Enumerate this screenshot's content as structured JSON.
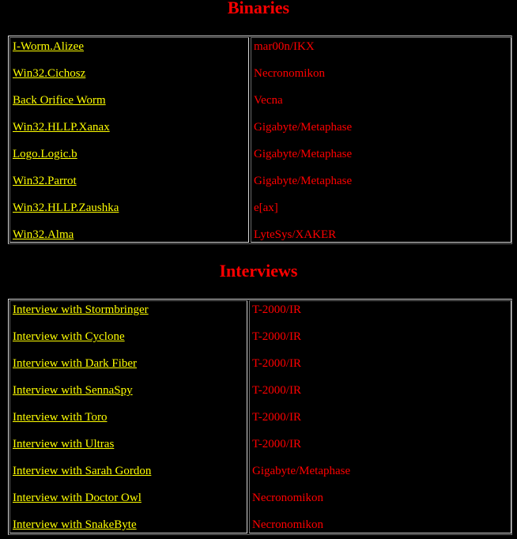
{
  "colors": {
    "background": "#000000",
    "heading": "#ff0000",
    "link": "#ffff00",
    "author": "#ff0000"
  },
  "binaries": {
    "title": "Binaries",
    "rows": [
      {
        "name": "I-Worm.Alizee",
        "author": "mar00n/IKX"
      },
      {
        "name": "Win32.Cichosz",
        "author": "Necronomikon"
      },
      {
        "name": "Back Orifice Worm",
        "author": "Vecna"
      },
      {
        "name": "Win32.HLLP.Xanax",
        "author": "Gigabyte/Metaphase"
      },
      {
        "name": "Logo.Logic.b",
        "author": "Gigabyte/Metaphase"
      },
      {
        "name": "Win32.Parrot",
        "author": "Gigabyte/Metaphase"
      },
      {
        "name": "Win32.HLLP.Zaushka",
        "author": "e[ax]"
      },
      {
        "name": "Win32.Alma",
        "author": "LyteSys/XAKER"
      }
    ]
  },
  "interviews": {
    "title": "Interviews",
    "rows": [
      {
        "name": "Interview with Stormbringer",
        "author": "T-2000/IR"
      },
      {
        "name": "Interview with Cyclone",
        "author": "T-2000/IR"
      },
      {
        "name": "Interview with Dark Fiber",
        "author": "T-2000/IR"
      },
      {
        "name": "Interview with SennaSpy",
        "author": "T-2000/IR"
      },
      {
        "name": "Interview with Toro",
        "author": "T-2000/IR"
      },
      {
        "name": "Interview with Ultras",
        "author": "T-2000/IR"
      },
      {
        "name": "Interview with Sarah Gordon",
        "author": "Gigabyte/Metaphase"
      },
      {
        "name": "Interview with Doctor Owl",
        "author": "Necronomikon"
      },
      {
        "name": "Interview with SnakeByte",
        "author": "Necronomikon"
      }
    ]
  }
}
